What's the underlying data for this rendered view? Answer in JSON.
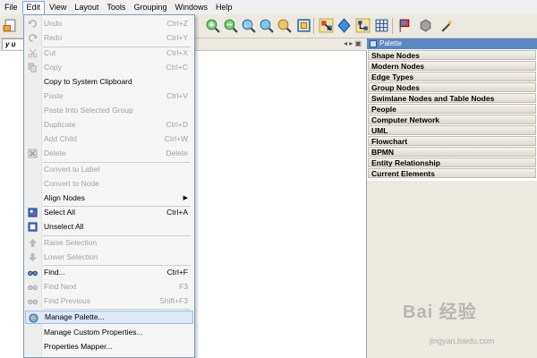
{
  "menubar": {
    "items": [
      "File",
      "Edit",
      "View",
      "Layout",
      "Tools",
      "Grouping",
      "Windows",
      "Help"
    ],
    "active": "Edit"
  },
  "doc_tab": {
    "label": "y u"
  },
  "palette": {
    "title": "Palette",
    "sections": [
      "Shape Nodes",
      "Modern Nodes",
      "Edge Types",
      "Group Nodes",
      "Swimlane Nodes and Table Nodes",
      "People",
      "Computer Network",
      "UML",
      "Flowchart",
      "BPMN",
      "Entity Relationship",
      "Current Elements"
    ]
  },
  "edit_menu": {
    "undo": {
      "label": "Undo",
      "shortcut": "Ctrl+Z"
    },
    "redo": {
      "label": "Redo",
      "shortcut": "Ctrl+Y"
    },
    "cut": {
      "label": "Cut",
      "shortcut": "Ctrl+X"
    },
    "copy": {
      "label": "Copy",
      "shortcut": "Ctrl+C"
    },
    "copy_to_clipboard": {
      "label": "Copy to System Clipboard"
    },
    "paste": {
      "label": "Paste",
      "shortcut": "Ctrl+V"
    },
    "paste_into_group": {
      "label": "Paste Into Selected Group"
    },
    "duplicate": {
      "label": "Duplicate",
      "shortcut": "Ctrl+D"
    },
    "add_child": {
      "label": "Add Child",
      "shortcut": "Ctrl+W"
    },
    "delete": {
      "label": "Delete",
      "shortcut": "Delete"
    },
    "convert_to_label": {
      "label": "Convert to Label"
    },
    "convert_to_node": {
      "label": "Convert to Node"
    },
    "align_nodes": {
      "label": "Align Nodes"
    },
    "select_all": {
      "label": "Select All",
      "shortcut": "Ctrl+A"
    },
    "unselect_all": {
      "label": "Unselect All"
    },
    "raise_selection": {
      "label": "Raise Selection"
    },
    "lower_selection": {
      "label": "Lower Selection"
    },
    "find": {
      "label": "Find...",
      "shortcut": "Ctrl+F"
    },
    "find_next": {
      "label": "Find Next",
      "shortcut": "F3"
    },
    "find_previous": {
      "label": "Find Previous",
      "shortcut": "Shift+F3"
    },
    "manage_palette": {
      "label": "Manage Palette..."
    },
    "manage_custom_props": {
      "label": "Manage Custom Properties..."
    },
    "properties_mapper": {
      "label": "Properties Mapper..."
    }
  },
  "watermark": {
    "main": "Bai 经验",
    "sub": "jingyan.baidu.com"
  }
}
